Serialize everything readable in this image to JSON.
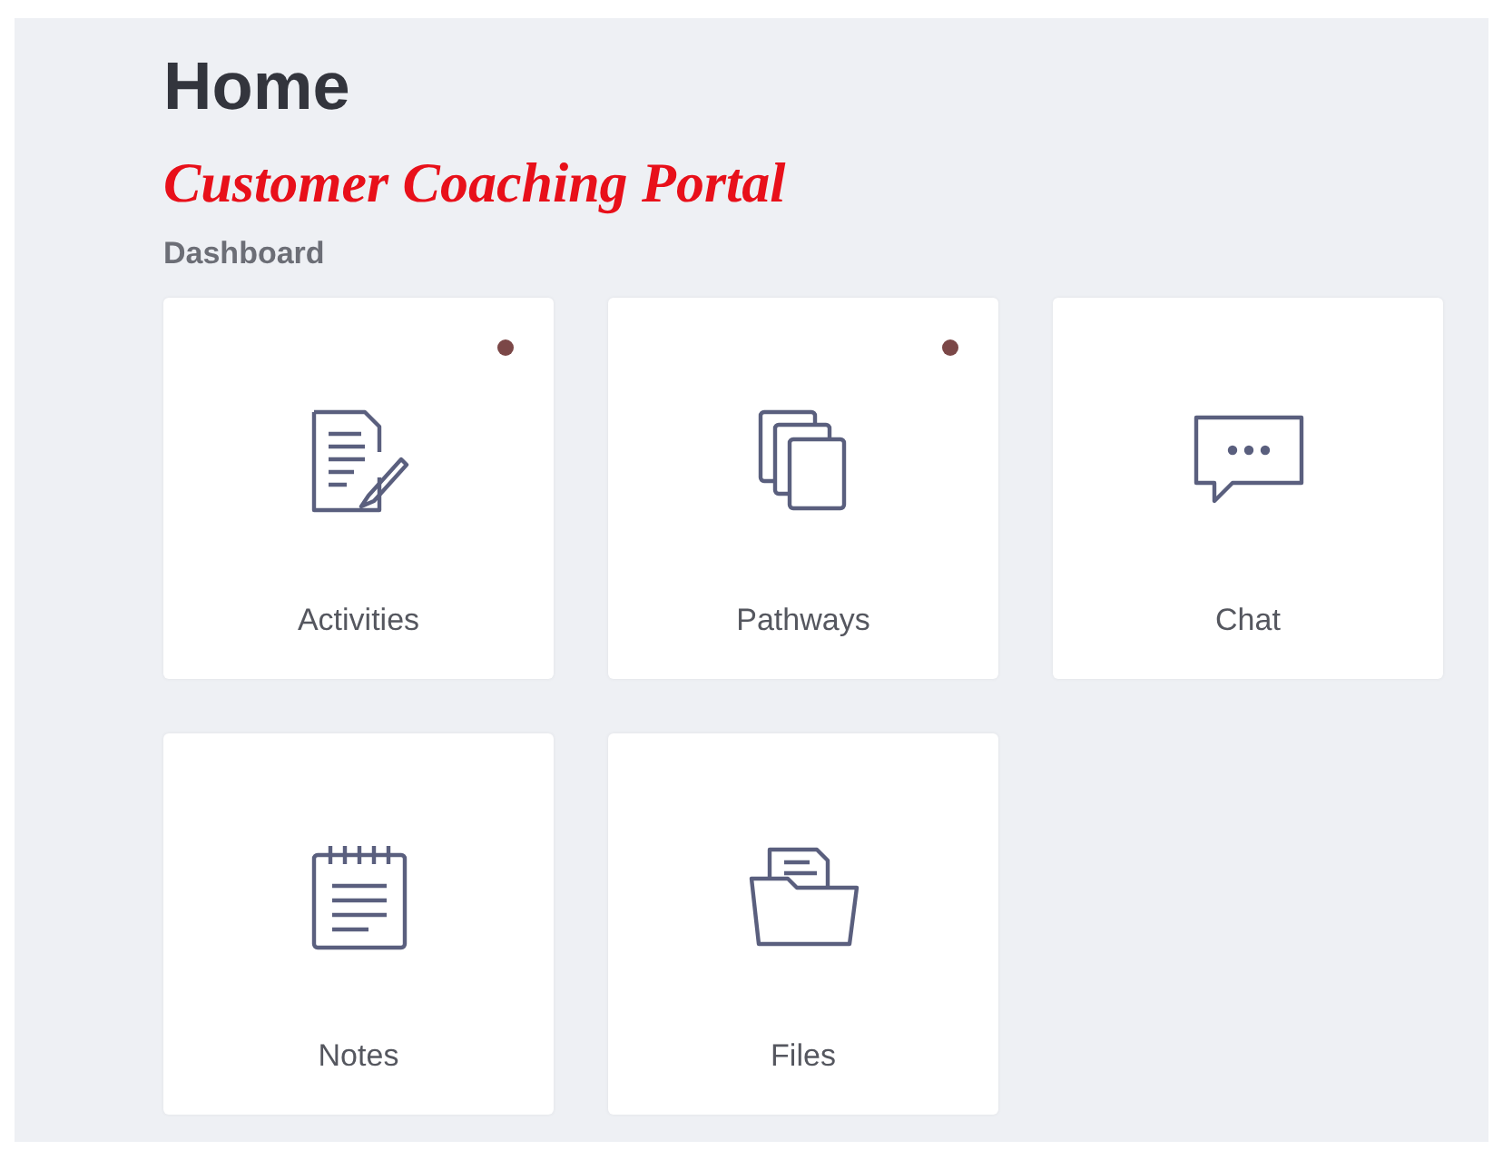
{
  "page": {
    "title": "Home",
    "subtitle": "Customer Coaching Portal",
    "section": "Dashboard"
  },
  "tiles": [
    {
      "label": "Activities",
      "kind": "document",
      "unread": true
    },
    {
      "label": "Pathways",
      "kind": "stack",
      "unread": true
    },
    {
      "label": "Chat",
      "kind": "chat",
      "unread": false
    },
    {
      "label": "Notes",
      "kind": "notepad",
      "unread": false
    },
    {
      "label": "Files",
      "kind": "folder",
      "unread": false
    }
  ]
}
